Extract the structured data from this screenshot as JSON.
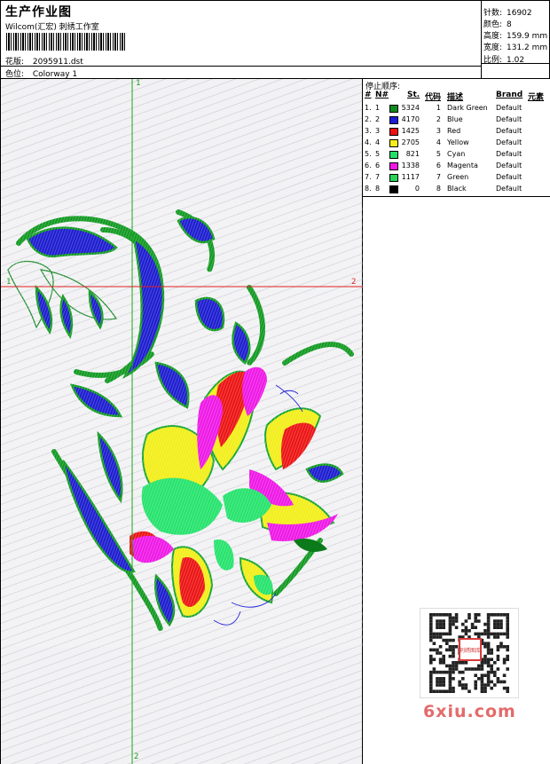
{
  "header": {
    "title": "生产作业图",
    "subtitle": "Wilcom(汇宏) 刺绣工作室",
    "design_label": "花版:",
    "design_file": "2095911.dst",
    "colorway_label": "色位:",
    "colorway": "Colorway 1"
  },
  "stats": {
    "stitches_label": "针数:",
    "stitches": "16902",
    "colors_label": "颜色:",
    "colors": "8",
    "height_label": "高度:",
    "height": "159.9 mm",
    "width_label": "宽度:",
    "width": "131.2 mm",
    "scale_label": "比例:",
    "scale": "1.02"
  },
  "axes": {
    "v_top": "1",
    "v_bottom": "2",
    "h_left": "1",
    "h_right": "2"
  },
  "table": {
    "title": "停止顺序:",
    "headers": [
      "#",
      "N#",
      "St.",
      "代码",
      "描述",
      "Brand",
      "元素"
    ],
    "rows": [
      {
        "num": "1.",
        "n": "1",
        "st": "5324",
        "code": "1",
        "desc": "Dark Green",
        "brand": "Default",
        "color": "#0e8a1e"
      },
      {
        "num": "2.",
        "n": "2",
        "st": "4170",
        "code": "2",
        "desc": "Blue",
        "brand": "Default",
        "color": "#1c1cd6"
      },
      {
        "num": "3.",
        "n": "3",
        "st": "1425",
        "code": "3",
        "desc": "Red",
        "brand": "Default",
        "color": "#ee1111"
      },
      {
        "num": "4.",
        "n": "4",
        "st": "2705",
        "code": "4",
        "desc": "Yellow",
        "brand": "Default",
        "color": "#f5f015"
      },
      {
        "num": "5.",
        "n": "5",
        "st": "821",
        "code": "5",
        "desc": "Cyan",
        "brand": "Default",
        "color": "#22e06a"
      },
      {
        "num": "6.",
        "n": "6",
        "st": "1338",
        "code": "6",
        "desc": "Magenta",
        "brand": "Default",
        "color": "#f017e8"
      },
      {
        "num": "7.",
        "n": "7",
        "st": "1117",
        "code": "7",
        "desc": "Green",
        "brand": "Default",
        "color": "#27d45a"
      },
      {
        "num": "8.",
        "n": "8",
        "st": "0",
        "code": "8",
        "desc": "Black",
        "brand": "Default",
        "color": "#000000"
      }
    ]
  },
  "watermark": "6xiu.com",
  "qr_stamp": "刺绣图库"
}
